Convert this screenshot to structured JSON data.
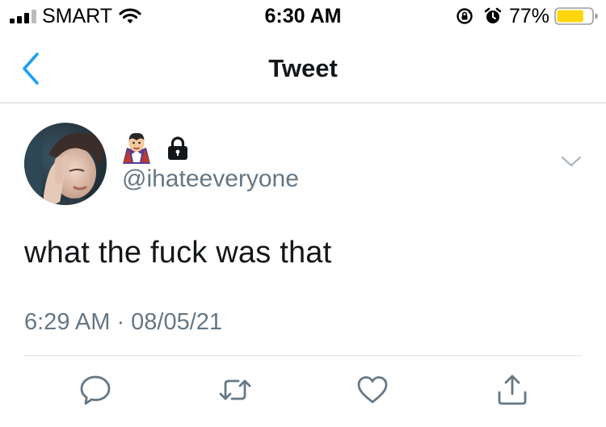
{
  "status_bar": {
    "carrier": "SMART",
    "time": "6:30 AM",
    "battery_percent": "77%",
    "battery_level": 0.77,
    "icons": [
      "signal-icon",
      "wifi-icon",
      "rotation-lock-icon",
      "alarm-icon",
      "battery-icon"
    ]
  },
  "nav": {
    "title": "Tweet",
    "back_icon": "chevron-left-icon"
  },
  "tweet": {
    "display_name_icons": [
      "vampire-emoji-icon",
      "lock-icon"
    ],
    "handle": "@ihateeveryone",
    "text": "what the fuck was that",
    "timestamp": "6:29 AM · 08/05/21",
    "caret_icon": "chevron-down-icon"
  },
  "actions": [
    {
      "name": "reply",
      "icon": "reply-icon"
    },
    {
      "name": "retweet",
      "icon": "retweet-icon"
    },
    {
      "name": "like",
      "icon": "heart-icon"
    },
    {
      "name": "share",
      "icon": "share-icon"
    }
  ],
  "colors": {
    "accent": "#1da1f2",
    "secondary_text": "#657786",
    "primary_text": "#14171a",
    "battery_fill": "#ffd60a",
    "divider": "#dfe3e6"
  }
}
